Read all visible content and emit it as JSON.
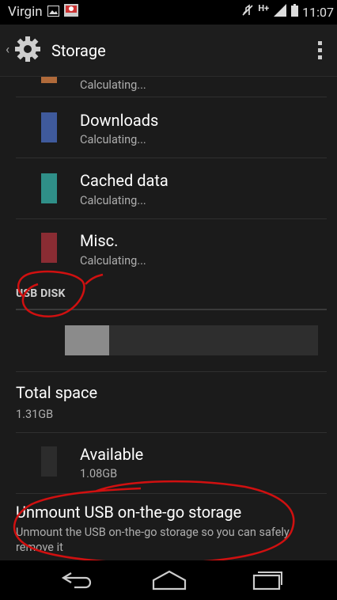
{
  "status_bar": {
    "carrier": "Virgin",
    "network_label": "H+",
    "time": "11:07"
  },
  "action_bar": {
    "title": "Storage"
  },
  "storage_items": [
    {
      "name": "",
      "subtitle": "Calculating...",
      "color": "#b06a3a"
    },
    {
      "name": "Downloads",
      "subtitle": "Calculating...",
      "color": "#3f5a9c"
    },
    {
      "name": "Cached data",
      "subtitle": "Calculating...",
      "color": "#2f8f88"
    },
    {
      "name": "Misc.",
      "subtitle": "Calculating...",
      "color": "#8a2c33"
    }
  ],
  "usb_section": {
    "header": "USB DISK",
    "usage_fraction": 0.175,
    "total_space_label": "Total space",
    "total_space_value": "1.31GB",
    "available_label": "Available",
    "available_value": "1.08GB",
    "available_color": "#2c2c2c",
    "unmount_title": "Unmount USB on-the-go storage",
    "unmount_summary": "Unmount the USB on-the-go storage so you can safely remove it"
  },
  "nav_bar": {
    "icons": [
      "back-icon",
      "home-icon",
      "recents-icon"
    ]
  }
}
